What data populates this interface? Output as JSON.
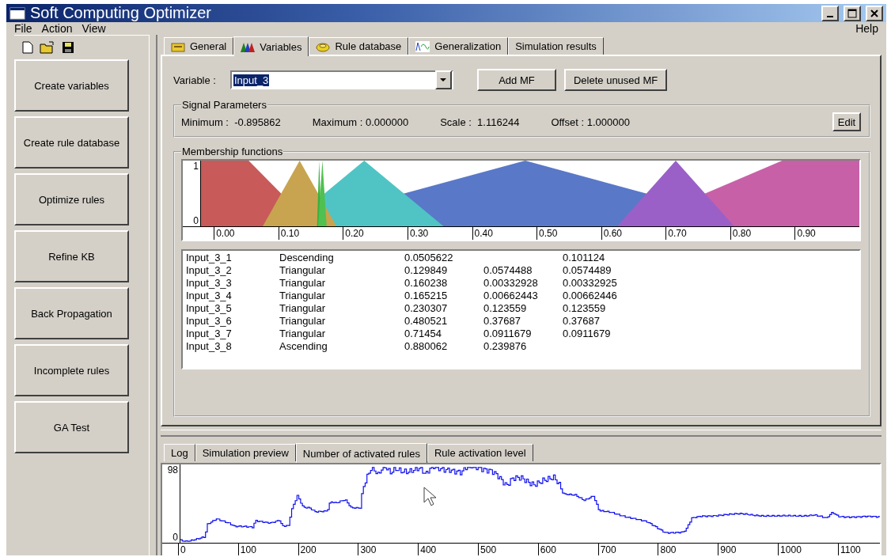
{
  "window": {
    "title": "Soft Computing Optimizer"
  },
  "menu": {
    "left": [
      "File",
      "Action",
      "View"
    ],
    "right": [
      "Help"
    ]
  },
  "actions": [
    "Create variables",
    "Create rule database",
    "Optimize rules",
    "Refine KB",
    "Back Propagation",
    "Incomplete rules",
    "GA Test"
  ],
  "tabs": [
    {
      "label": "General",
      "kind": "folder",
      "selected": false
    },
    {
      "label": "Variables",
      "kind": "triangles",
      "selected": true
    },
    {
      "label": "Rule database",
      "kind": "disc",
      "selected": false
    },
    {
      "label": "Generalization",
      "kind": "wave",
      "selected": false
    },
    {
      "label": "Simulation results",
      "selected": false
    }
  ],
  "variable": {
    "label": "Variable :",
    "value": "Input_3",
    "buttons": [
      "Add MF",
      "Delete unused MF"
    ]
  },
  "signal_parameters": {
    "title": "Signal Parameters",
    "items": [
      "Minimum :  -0.895862",
      "Maximum : 0.000000",
      "Scale :  1.116244",
      "Offset : 1.000000"
    ],
    "edit_button": "Edit"
  },
  "membership_functions": {
    "title": "Membership functions",
    "y_labels": [
      "1",
      "0"
    ],
    "x_labels": [
      "0.00",
      "0.10",
      "0.20",
      "0.30",
      "0.40",
      "0.50",
      "0.60",
      "0.70",
      "0.80",
      "0.90"
    ],
    "rows": [
      {
        "label": "Input_3_1",
        "shape": "Descending",
        "kind": "descending",
        "color": "#c85a5a",
        "column_3": "0.0505622",
        "column_5": "0.101124"
      },
      {
        "label": "Input_3_2",
        "shape": "Triangular",
        "kind": "triangular",
        "color": "#c8a450",
        "column_3": "0.129849",
        "column_4": "0.0574488",
        "column_5": "0.0574489"
      },
      {
        "label": "Input_3_3",
        "shape": "Triangular",
        "kind": "triangular",
        "color": "#38b040",
        "column_3": "0.160238",
        "column_4": "0.00332928",
        "column_5": "0.00332925"
      },
      {
        "label": "Input_3_4",
        "shape": "Triangular",
        "kind": "triangular",
        "color": "#50c050",
        "column_3": "0.165215",
        "column_4": "0.00662443",
        "column_5": "0.00662446"
      },
      {
        "label": "Input_3_5",
        "shape": "Triangular",
        "kind": "triangular",
        "color": "#50c4c4",
        "column_3": "0.230307",
        "column_4": "0.123559",
        "column_5": "0.123559"
      },
      {
        "label": "Input_3_6",
        "shape": "Triangular",
        "kind": "triangular",
        "color": "#5a78c8",
        "column_3": "0.480521",
        "column_4": "0.37687",
        "column_5": "0.37687"
      },
      {
        "label": "Input_3_7",
        "shape": "Triangular",
        "kind": "triangular",
        "color": "#9a60c8",
        "column_3": "0.71454",
        "column_4": "0.0911679",
        "column_5": "0.0911679"
      },
      {
        "label": "Input_3_8",
        "shape": "Ascending",
        "kind": "ascending",
        "color": "#c860a8",
        "column_3": "0.880062",
        "column_4": "0.239876"
      }
    ]
  },
  "bottom_tabs": [
    {
      "label": "Log",
      "selected": false
    },
    {
      "label": "Simulation preview",
      "selected": false
    },
    {
      "label": "Number of activated rules",
      "selected": true
    },
    {
      "label": "Rule activation level",
      "selected": false
    }
  ],
  "activation_chart": {
    "y_labels": [
      "98",
      "0"
    ],
    "x_labels": [
      "0",
      "100",
      "200",
      "300",
      "400",
      "500",
      "600",
      "700",
      "800",
      "900",
      "1000",
      "1100"
    ]
  }
}
